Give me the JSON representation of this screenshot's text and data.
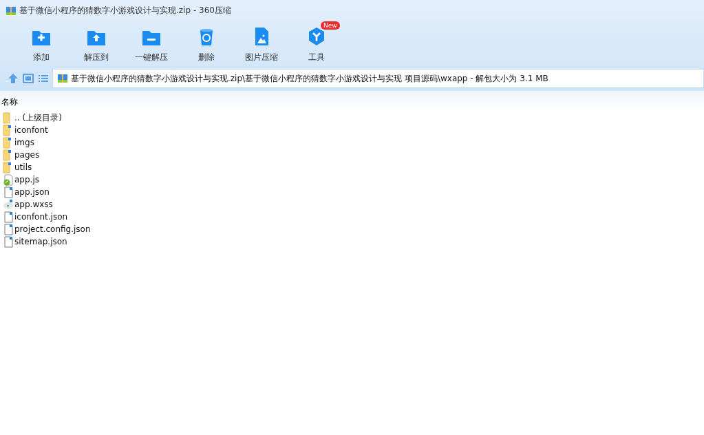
{
  "window": {
    "title": "基于微信小程序的猜数字小游戏设计与实现.zip - 360压缩"
  },
  "toolbar": [
    {
      "label": "添加",
      "kind": "add"
    },
    {
      "label": "解压到",
      "kind": "extract"
    },
    {
      "label": "一键解压",
      "kind": "oneclick"
    },
    {
      "label": "删除",
      "kind": "delete"
    },
    {
      "label": "图片压缩",
      "kind": "image"
    },
    {
      "label": "工具",
      "kind": "tools",
      "badge": "New"
    }
  ],
  "address": {
    "path": "基于微信小程序的猜数字小游戏设计与实现.zip\\基于微信小程序的猜数字小游戏设计与实现 项目源码\\wxapp - 解包大小为 3.1 MB"
  },
  "file_list": {
    "columns": [
      "名称"
    ],
    "rows": [
      {
        "name": ".. (上级目录)",
        "kind": "up"
      },
      {
        "name": "iconfont",
        "kind": "folder"
      },
      {
        "name": "imgs",
        "kind": "folder"
      },
      {
        "name": "pages",
        "kind": "folder"
      },
      {
        "name": "utils",
        "kind": "folder"
      },
      {
        "name": "app.js",
        "kind": "script"
      },
      {
        "name": "app.json",
        "kind": "file"
      },
      {
        "name": "app.wxss",
        "kind": "style"
      },
      {
        "name": "iconfont.json",
        "kind": "file"
      },
      {
        "name": "project.config.json",
        "kind": "file"
      },
      {
        "name": "sitemap.json",
        "kind": "file"
      }
    ]
  }
}
